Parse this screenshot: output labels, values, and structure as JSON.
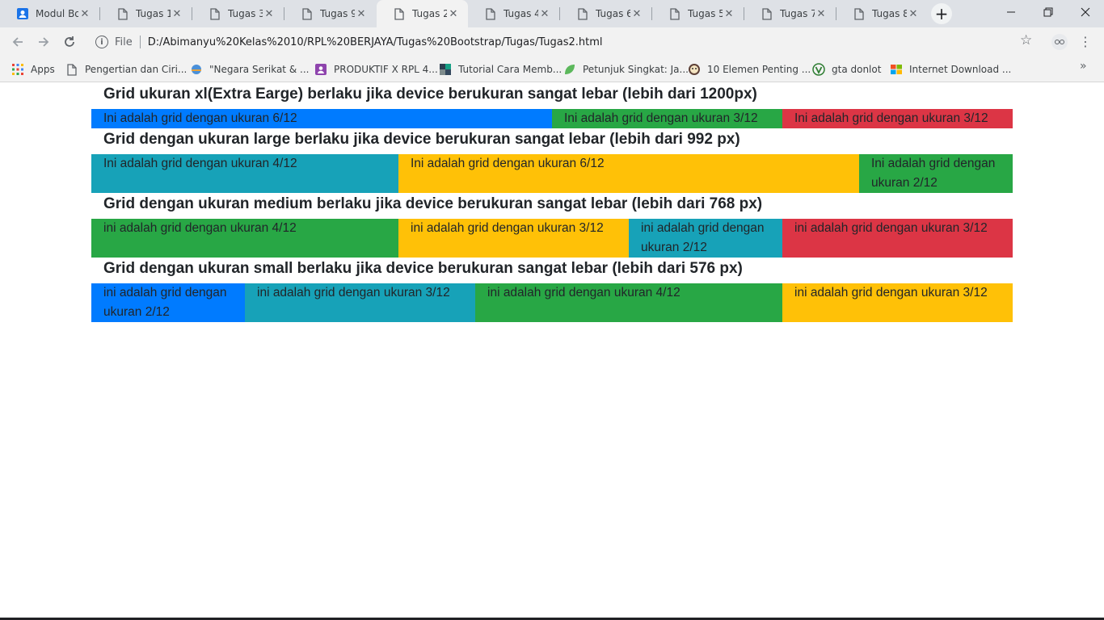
{
  "browser": {
    "tabs": [
      {
        "title": "Modul Bo",
        "active": false,
        "icon": "profile-favicon-icon"
      },
      {
        "title": "Tugas 1",
        "active": false,
        "icon": "document-icon"
      },
      {
        "title": "Tugas 3",
        "active": false,
        "icon": "document-icon"
      },
      {
        "title": "Tugas 9",
        "active": false,
        "icon": "document-icon"
      },
      {
        "title": "Tugas 2",
        "active": true,
        "icon": "document-icon"
      },
      {
        "title": "Tugas 4",
        "active": false,
        "icon": "document-icon"
      },
      {
        "title": "Tugas 6",
        "active": false,
        "icon": "document-icon"
      },
      {
        "title": "Tugas 5",
        "active": false,
        "icon": "document-icon"
      },
      {
        "title": "Tugas 7",
        "active": false,
        "icon": "document-icon"
      },
      {
        "title": "Tugas 8",
        "active": false,
        "icon": "document-icon"
      }
    ],
    "new_tab": "+",
    "address": {
      "scheme_label": "File",
      "url": "D:/Abimanyu%20Kelas%2010/RPL%20BERJAYA/Tugas%20Bootstrap/Tugas/Tugas2.html"
    },
    "bookmarks": [
      {
        "label": "Apps",
        "icon": "apps-grid-icon"
      },
      {
        "label": "Pengertian dan Ciri...",
        "icon": "document-icon"
      },
      {
        "label": "\"Negara Serikat & ...",
        "icon": "globe-favicon-icon"
      },
      {
        "label": "PRODUKTIF X RPL 4...",
        "icon": "classroom-favicon-icon"
      },
      {
        "label": "Tutorial Cara Memb...",
        "icon": "blog-favicon-icon"
      },
      {
        "label": "Petunjuk Singkat: Ja...",
        "icon": "leaf-favicon-icon"
      },
      {
        "label": "10 Elemen Penting ...",
        "icon": "face-favicon-icon"
      },
      {
        "label": "gta donlot",
        "icon": "v-favicon-icon"
      },
      {
        "label": "Internet Download ...",
        "icon": "windows-favicon-icon"
      }
    ],
    "bookmarks_more": "»"
  },
  "colors": {
    "blue": "#007bff",
    "green": "#28a745",
    "red": "#dc3545",
    "cyan": "#17a2b8",
    "yellow": "#ffc107"
  },
  "page": {
    "sections": [
      {
        "heading": "Grid ukuran xl(Extra Earge) berlaku jika device berukuran sangat lebar (lebih dari 1200px)",
        "cells": [
          {
            "text": "Ini adalah grid dengan ukuran 6/12",
            "color": "blue",
            "span": 6
          },
          {
            "text": "Ini adalah grid dengan ukuran 3/12",
            "color": "green",
            "span": 3
          },
          {
            "text": "Ini adalah grid dengan ukuran 3/12",
            "color": "red",
            "span": 3
          }
        ]
      },
      {
        "heading": "Grid dengan ukuran large berlaku jika device berukuran sangat lebar (lebih dari 992 px)",
        "cells": [
          {
            "text": "Ini adalah grid dengan ukuran 4/12",
            "color": "cyan",
            "span": 4
          },
          {
            "text": "Ini adalah grid dengan ukuran 6/12",
            "color": "yellow",
            "span": 6
          },
          {
            "text": "Ini adalah grid dengan ukuran 2/12",
            "color": "green",
            "span": 2
          }
        ]
      },
      {
        "heading": "Grid dengan ukuran medium berlaku jika device berukuran sangat lebar (lebih dari 768 px)",
        "cells": [
          {
            "text": "ini adalah grid dengan ukuran 4/12",
            "color": "green",
            "span": 4
          },
          {
            "text": "ini adalah grid dengan ukuran 3/12",
            "color": "yellow",
            "span": 3
          },
          {
            "text": "ini adalah grid dengan ukuran 2/12",
            "color": "cyan",
            "span": 2
          },
          {
            "text": "ini adalah grid dengan ukuran 3/12",
            "color": "red",
            "span": 3
          }
        ]
      },
      {
        "heading": "Grid dengan ukuran small berlaku jika device berukuran sangat lebar (lebih dari 576 px)",
        "cells": [
          {
            "text": "ini adalah grid dengan ukuran 2/12",
            "color": "blue",
            "span": 2
          },
          {
            "text": "ini adalah grid dengan ukuran 3/12",
            "color": "cyan",
            "span": 3
          },
          {
            "text": "ini adalah grid dengan ukuran 4/12",
            "color": "green",
            "span": 4
          },
          {
            "text": "ini adalah grid dengan ukuran 3/12",
            "color": "yellow",
            "span": 3
          }
        ]
      }
    ]
  }
}
